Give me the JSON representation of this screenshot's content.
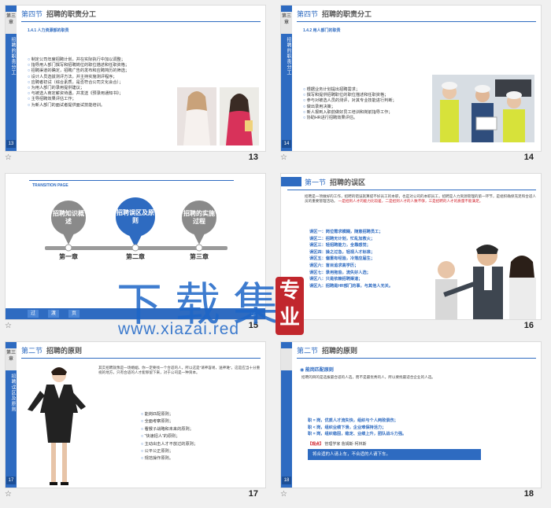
{
  "slides": [
    {
      "page": "13",
      "vbar_tab": "第三章",
      "vbar_text": "招聘的职责分工",
      "vbar_pno": "13",
      "title_prefix": "第四节",
      "title": "招聘的职责分工",
      "sub": "1.4.1 人力资源部的职责",
      "items": [
        "制定公司年度招聘计划，并在实际执行中加以调整；",
        "指导用人部门撰写和招聘岗位的职位描述和任职资格；",
        "招聘渠道的确定，招聘广告的发布和应聘简历的筛选；",
        "设计人员选拔测评方法，并主持实施测评程序；",
        "应聘者初试（综合素质，是否符合公司文化会合）；",
        "为用人部门的录用提供建议；",
        "与被选人商定薪资待遇，并发送《预录用通知书》；",
        "主导招聘效果评估工作；",
        "为新人部门的面试者提供面试技能培训。"
      ]
    },
    {
      "page": "14",
      "vbar_tab": "第三章",
      "vbar_text": "招聘的职责分工",
      "vbar_pno": "14",
      "title_prefix": "第四节",
      "title": "招聘的职责分工",
      "sub": "1.4.2 用人部门的职责",
      "items": [
        "根据业务计划提出招聘需求；",
        "撰写和提供招聘职位的职位描述和任职资格；",
        "参与对被选人员的测评，对其专业技能进行判断；",
        "做出录用决策；",
        "新人报到入职前做好员工培训和岗前指导工作；",
        "协助HR进行招聘效果评估。"
      ]
    },
    {
      "page": "15",
      "banner": "TRANSITION PAGE",
      "pins": [
        "招聘知识概述",
        "招聘误区及原则",
        "招聘的实施过程"
      ],
      "chapters": [
        "第一章",
        "第二章",
        "第三章"
      ],
      "tabs": [
        "过",
        "渡",
        "页"
      ],
      "pno": "15"
    },
    {
      "page": "16",
      "title_prefix": "第一节",
      "title": "招聘的误区",
      "intro": "招聘是一项做好的工作，招聘的错误就算提不好员工的本职，也是对公司的本职员工，招聘是人力资源管理的第一环节，是组织确保充足和合适人员的重要管理活动。",
      "intro2": "一是招到人才的能力比较差，二是招到人才的人数不够，三是招聘的人才的质量不能满足。",
      "items": [
        "误区一：岗位需求模糊，随意招聘员工；",
        "误区二：招聘无计划，忙乱加救火；",
        "误区三：轻招聘能力，全靠感觉；",
        "误区四：操之过急，轻视人才标准；",
        "误区五：偏重有经验，冷落应届生；",
        "误区六：盲目追求高学历；",
        "误区七：录用拖沓，流失好人选；",
        "误区八：只是依赖招聘渠道；",
        "误区九：招聘是HR部门的事，与其他人无关。"
      ]
    },
    {
      "page": "17",
      "vbar_tab": "第三章",
      "vbar_text": "招聘误区及原则",
      "vbar_pno": "17",
      "title_prefix": "第二节",
      "title": "招聘的原则",
      "intro": "其实招聘就像是一场婚姻，你一定要找一个合适的人，所以这是“请神容易，送神难”。这是应当十分重视的地方，只有合适的人才能够留下来，对于公司是一种资本。",
      "items": [
        "能岗匹配原则；",
        "全面考察原则；",
        "看猴子战略和未来的原则；",
        "“快速招人”的原则；",
        "主动出击人才不放过的原则；",
        "公平公正原则；",
        "规范操作原则。"
      ]
    },
    {
      "page": "18",
      "title_prefix": "第二节",
      "title": "招聘的原则",
      "sub": "能岗匹配原则",
      "body": "招聘的目的是选拔最合适的人选，而不是最优秀的人，所以要找最适合企业的人选。",
      "lines": [
        "职 = 岗，优质人才流失快，组织与个人两败俱伤；",
        "职 < 岗，组织业绩下滑，企业难保持活力；",
        "职 = 岗，组织稳固，稳定、业绩上升，团队战斗力强。"
      ],
      "point_label": "【观点】",
      "point_text": "管理学家 詹姆斯·柯林斯",
      "quote": "将合适的人请上车，不合适的人请下车。"
    }
  ],
  "watermark": {
    "cn": "下载集",
    "url": "www.xiazai.red",
    "seal": "专业"
  },
  "footer_icon": "star-icon"
}
